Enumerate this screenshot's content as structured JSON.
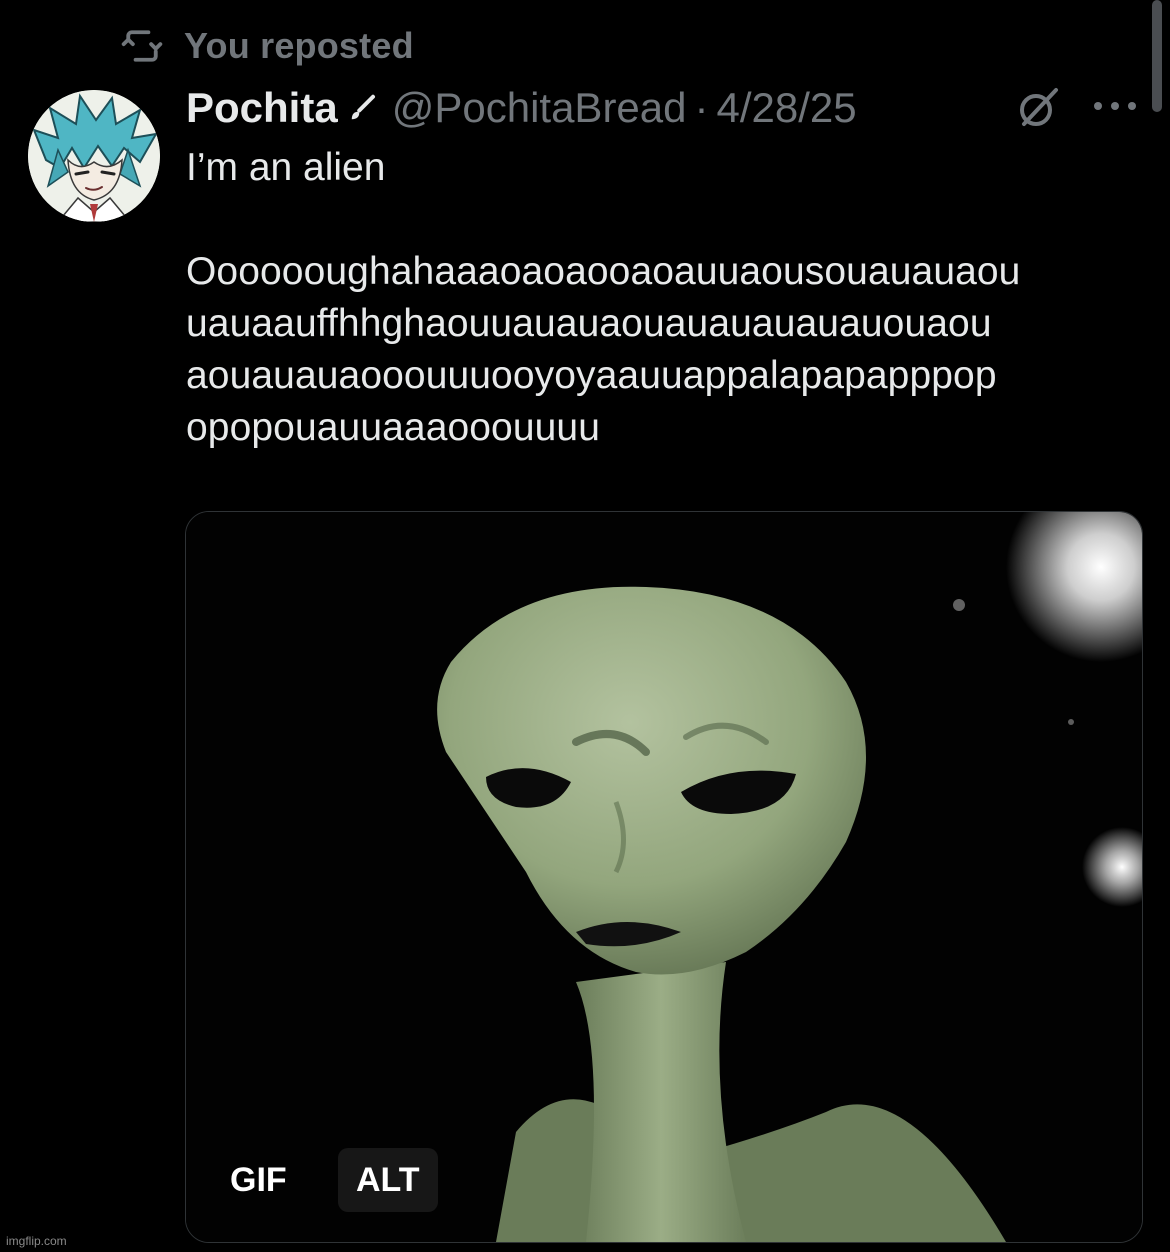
{
  "repost": {
    "icon": "repost-icon",
    "text": "You reposted"
  },
  "tweet": {
    "author": {
      "display_name": "Pochita",
      "badge_icon": "pencil-icon",
      "handle": "@PochitaBread",
      "avatar_icon": "anime-avatar"
    },
    "separator": "·",
    "date": "4/28/25",
    "text": {
      "first_line": "I’m an alien",
      "lines": [
        "Ooooooughahaaaoaoaooaoauuaousouauauaou",
        "uauaauffhhghaouuauauaouauauauauauouaou",
        "aouauauaooouuuooyoyaauuappalapapapppop",
        "opopouauuaaaooouuuu"
      ]
    },
    "media": {
      "type": "gif",
      "gif_label": "GIF",
      "alt_label": "ALT"
    },
    "actions": {
      "grok_icon": "grok-icon",
      "more_icon": "more-options-icon"
    }
  },
  "watermark": "imgflip.com",
  "colors": {
    "background": "#000000",
    "primary_text": "#e7e9ea",
    "secondary_text": "#71767b",
    "alien_green": "#9aac85"
  }
}
